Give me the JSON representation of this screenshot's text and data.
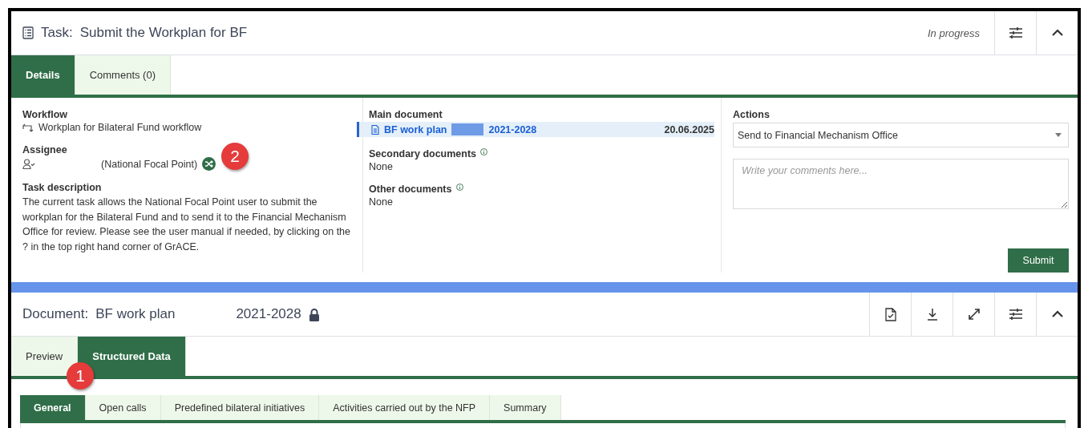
{
  "task": {
    "label": "Task:",
    "title": "Submit the Workplan for BF",
    "status": "In progress",
    "tabs": [
      {
        "label": "Details",
        "selected": true
      },
      {
        "label": "Comments (0)",
        "selected": false
      }
    ],
    "workflow": {
      "label": "Workflow",
      "value": "Workplan for Bilateral Fund workflow"
    },
    "assignee": {
      "label": "Assignee",
      "role": "(National Focal Point)",
      "callout": "2"
    },
    "description": {
      "label": "Task description",
      "text": "The current task allows the National Focal Point user to submit the workplan for the Bilateral Fund and to send it to the Financial Mechanism Office for review. Please see the user manual if needed, by clicking on the ? in the top right hand corner of GrACE."
    },
    "main_document": {
      "label": "Main document",
      "name": "BF work plan",
      "version": "2021-2028",
      "date": "20.06.2025"
    },
    "secondary_documents": {
      "label": "Secondary documents",
      "value": "None"
    },
    "other_documents": {
      "label": "Other documents",
      "value": "None"
    },
    "actions": {
      "label": "Actions",
      "action": "Send to Financial Mechanism Office",
      "comment_placeholder": "Write your comments here...",
      "submit": "Submit"
    }
  },
  "document": {
    "label": "Document:",
    "name": "BF work plan",
    "version": "2021-2028",
    "locked": true,
    "tabs": [
      {
        "label": "Preview",
        "selected": false
      },
      {
        "label": "Structured Data",
        "selected": true,
        "callout": "1"
      }
    ],
    "section_tabs": [
      {
        "label": "General",
        "selected": true
      },
      {
        "label": "Open calls",
        "selected": false
      },
      {
        "label": "Predefined bilateral initiatives",
        "selected": false
      },
      {
        "label": "Activities carried out by the NFP",
        "selected": false
      },
      {
        "label": "Summary",
        "selected": false
      }
    ]
  }
}
